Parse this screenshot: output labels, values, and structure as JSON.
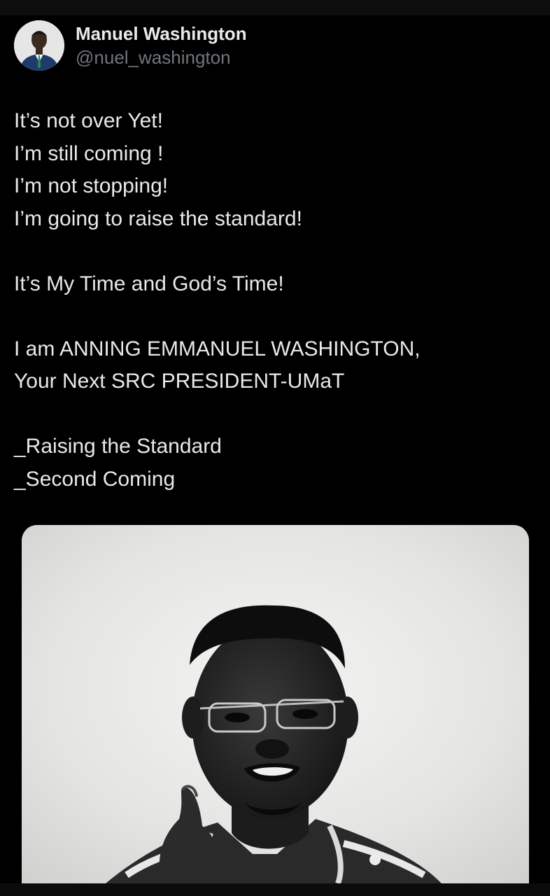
{
  "tweet": {
    "author": {
      "display_name": "Manuel Washington",
      "handle": "@nuel_washington"
    },
    "text_lines": [
      "It’s not over Yet!",
      "I’m still coming !",
      "I’m not stopping!",
      "I’m going to raise the standard!",
      "",
      "It’s My Time and God’s Time!",
      "",
      "I am ANNING EMMANUEL WASHINGTON,",
      "Your Next SRC PRESIDENT-UMaT",
      "",
      "_Raising the Standard",
      "_Second Coming"
    ]
  },
  "colors": {
    "background": "#000000",
    "primary_text": "#e7e9ea",
    "secondary_text": "#71767b"
  }
}
